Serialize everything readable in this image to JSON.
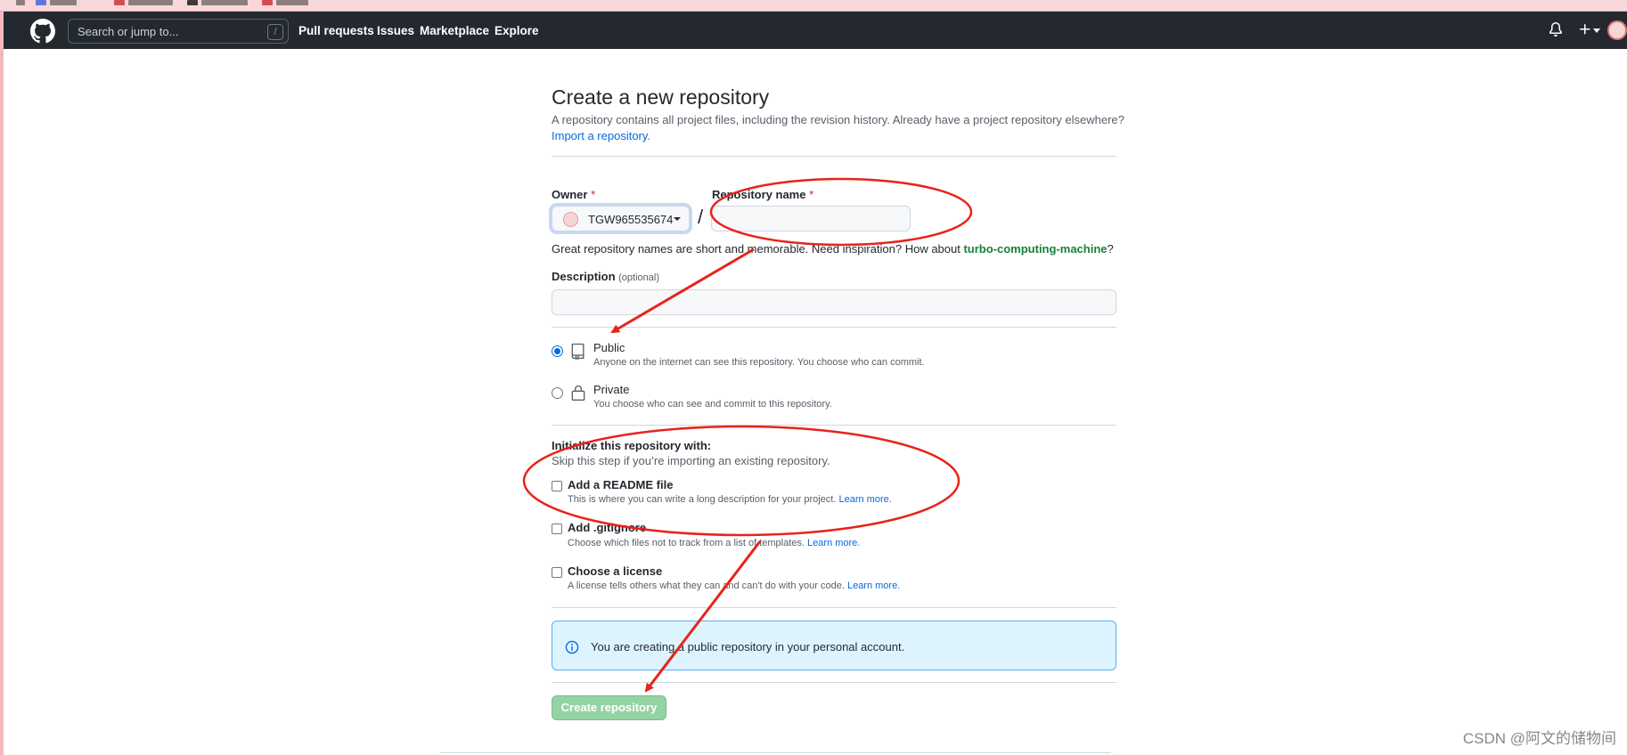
{
  "header": {
    "search_placeholder": "Search or jump to...",
    "search_shortcut": "/",
    "nav": [
      "Pull requests",
      "Issues",
      "Marketplace",
      "Explore"
    ],
    "plus_label": "+"
  },
  "page": {
    "title": "Create a new repository",
    "subtitle": "A repository contains all project files, including the revision history. Already have a project repository elsewhere?",
    "import_link": "Import a repository."
  },
  "form": {
    "owner_label": "Owner",
    "owner_value": "TGW965535674",
    "required_mark": "*",
    "separator": "/",
    "repo_name_label": "Repository name",
    "repo_name_value": "",
    "hint_text": "Great repository names are short and memorable. Need inspiration? How about ",
    "hint_suggestion": "turbo-computing-machine",
    "hint_end": "?",
    "description_label": "Description",
    "description_optional": "(optional)",
    "description_value": ""
  },
  "visibility": {
    "options": [
      {
        "title": "Public",
        "desc": "Anyone on the internet can see this repository. You choose who can commit.",
        "checked": true
      },
      {
        "title": "Private",
        "desc": "You choose who can see and commit to this repository.",
        "checked": false
      }
    ]
  },
  "initialize": {
    "heading": "Initialize this repository with:",
    "subheading": "Skip this step if you’re importing an existing repository.",
    "items": [
      {
        "title": "Add a README file",
        "desc": "This is where you can write a long description for your project.",
        "link": "Learn more."
      },
      {
        "title": "Add .gitignore",
        "desc": "Choose which files not to track from a list of templates.",
        "link": "Learn more."
      },
      {
        "title": "Choose a license",
        "desc": "A license tells others what they can and can't do with your code.",
        "link": "Learn more."
      }
    ]
  },
  "info": {
    "text": "You are creating a public repository in your personal account."
  },
  "create_button": "Create repository",
  "watermark": "CSDN @阿文的储物间",
  "annotation_color": "#e8231a"
}
